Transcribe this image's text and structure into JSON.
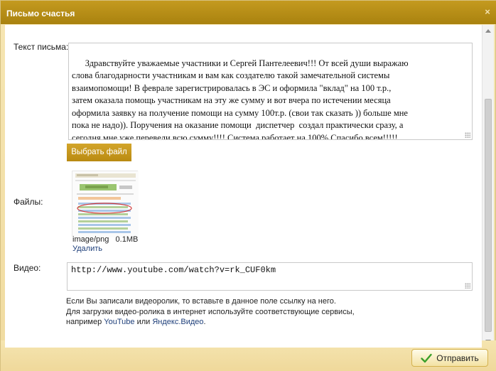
{
  "dialog": {
    "title": "Письмо счастья",
    "close_glyph": "×"
  },
  "form": {
    "letter_label": "Текст письма:",
    "letter_text": "Здравствуйте уважаемые участники и Сергей Пантелеевич!!! От всей души выражаю\nслова благодарности участникам и вам как создателю такой замечательной системы\nвзаимопомощи! В феврале зарегистрировалась в ЭС и оформила \"вклад\" на 100 т.р.,\nзатем оказала помощь участникам на эту же сумму и вот вчера по истечении месяца\nоформила заявку на получение помощи на сумму 100т.р. (свои так сказать )) больше мне\nпока не надо)). Поручения на оказание помощи  диспетчер  создал практически сразу, а\nсегодня мне уже перевели всю сумму!!!! Система работает на 100% Спасибо всем!!!!!\nМы Можем Многое!!!",
    "choose_file_label": "Выбрать файл",
    "files_label": "Файлы:",
    "file_type": "image/png",
    "file_size": "0.1MB",
    "delete_label": "Удалить",
    "video_label": "Видео:",
    "video_value": "http://www.youtube.com/watch?v=rk_CUF0km",
    "hint_line1": "Если Вы записали видеоролик, то вставьте в данное поле ссылку на него.",
    "hint_line2": "Для загрузки видео-ролика в интернет используйте соответствующие сервисы,",
    "hint_line3_prefix": "например",
    "hint_link_youtube": "YouTube",
    "hint_or": "или",
    "hint_link_yandex": "Яндекс.Видео",
    "hint_period": "."
  },
  "footer": {
    "send_label": "Отправить"
  },
  "icons": {
    "send": "check-icon",
    "close": "close-icon"
  },
  "colors": {
    "title_bar": "#b38c17",
    "button_gold": "#c99a1d",
    "link": "#1e3f7a",
    "panel_bg": "#f3dfa6",
    "check_green": "#3aa02a"
  }
}
